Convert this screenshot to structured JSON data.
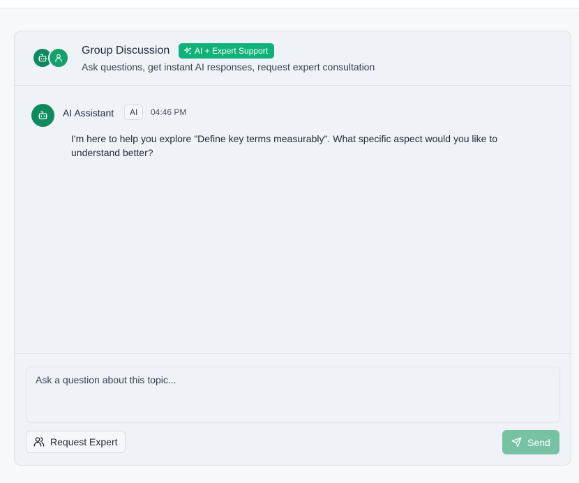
{
  "header": {
    "title": "Group Discussion",
    "badge": "AI + Expert Support",
    "subtitle": "Ask questions, get instant AI responses, request expert consultation",
    "avatars": [
      "bot-icon",
      "user-icon"
    ]
  },
  "messages": [
    {
      "sender": "AI Assistant",
      "role": "AI",
      "time": "04:46 PM",
      "text": "I'm here to help you explore \"Define key terms measurably\". What specific aspect would you like to understand better?",
      "avatar_icon": "bot-icon"
    }
  ],
  "composer": {
    "placeholder": "Ask a question about this topic...",
    "value": "",
    "request_expert_label": "Request Expert",
    "send_label": "Send"
  },
  "colors": {
    "accent": "#0f8a5f",
    "badge": "#10b27a",
    "send_disabled": "#78c2a4",
    "panel_bg": "#eff2f7"
  }
}
